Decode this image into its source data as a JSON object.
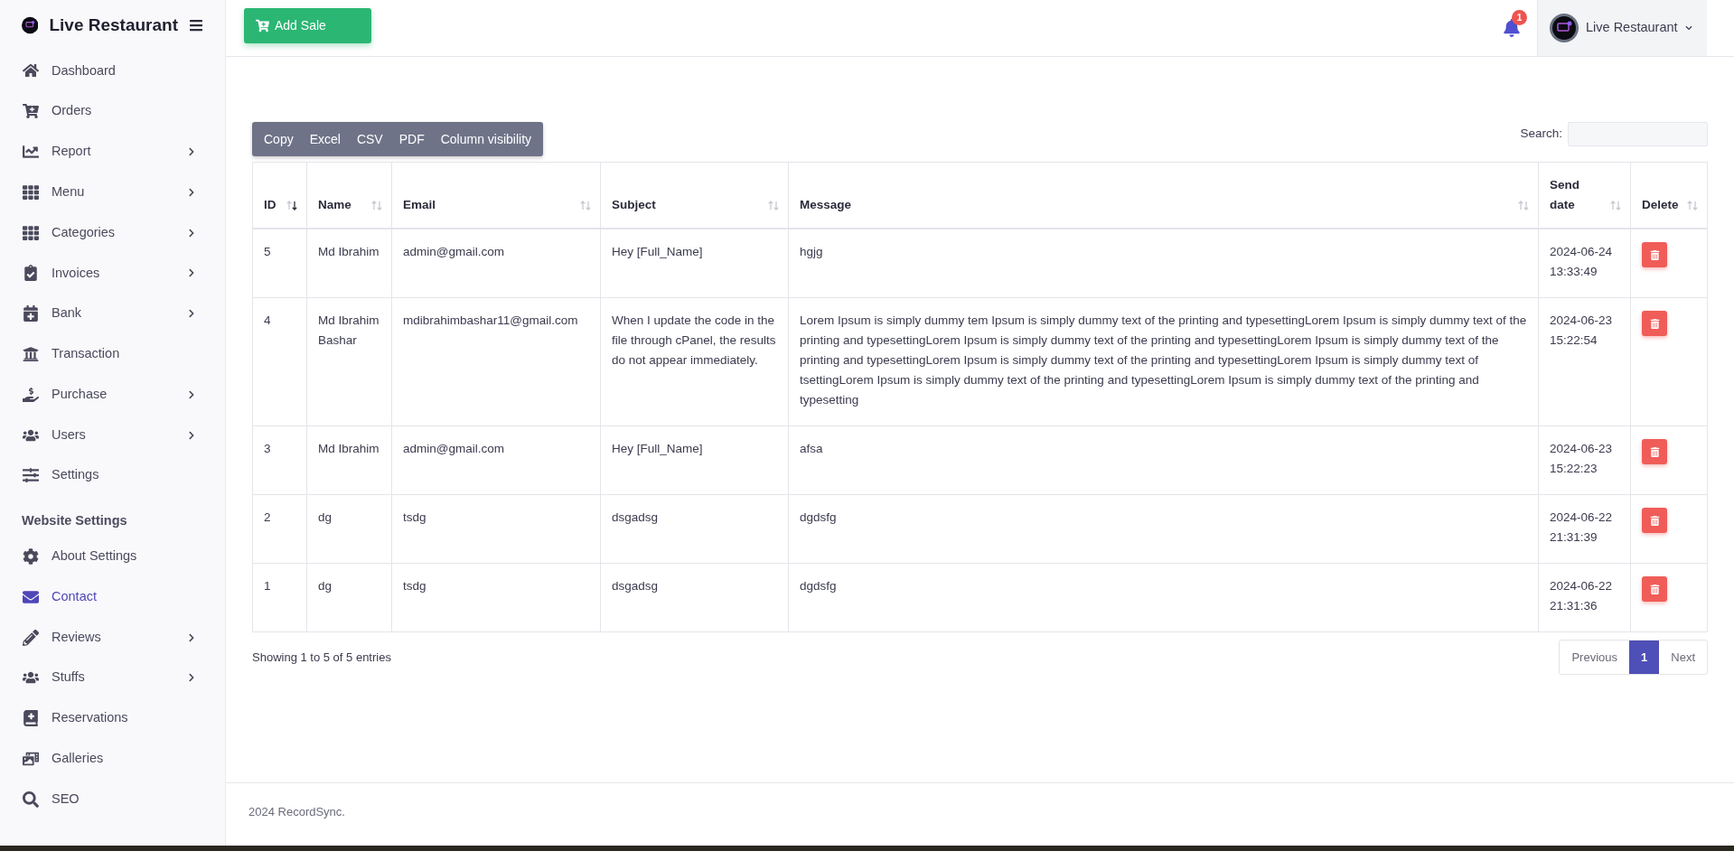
{
  "sidebar": {
    "brand": "Live Restaurant",
    "items": [
      {
        "kind": "link",
        "label": "Dashboard",
        "has_submenu": false,
        "selected": false
      },
      {
        "kind": "link",
        "label": "Orders",
        "has_submenu": false,
        "selected": false
      },
      {
        "kind": "link",
        "label": "Report",
        "has_submenu": true,
        "selected": false
      },
      {
        "kind": "link",
        "label": "Menu",
        "has_submenu": true,
        "selected": false
      },
      {
        "kind": "link",
        "label": "Categories",
        "has_submenu": true,
        "selected": false
      },
      {
        "kind": "link",
        "label": "Invoices",
        "has_submenu": true,
        "selected": false
      },
      {
        "kind": "link",
        "label": "Bank",
        "has_submenu": true,
        "selected": false
      },
      {
        "kind": "link",
        "label": "Transaction",
        "has_submenu": false,
        "selected": false
      },
      {
        "kind": "link",
        "label": "Purchase",
        "has_submenu": true,
        "selected": false
      },
      {
        "kind": "link",
        "label": "Users",
        "has_submenu": true,
        "selected": false
      },
      {
        "kind": "link",
        "label": "Settings",
        "has_submenu": false,
        "selected": false
      },
      {
        "kind": "heading",
        "label": "Website Settings"
      },
      {
        "kind": "link",
        "label": "About Settings",
        "has_submenu": false,
        "selected": false
      },
      {
        "kind": "link",
        "label": "Contact",
        "has_submenu": false,
        "selected": true
      },
      {
        "kind": "link",
        "label": "Reviews",
        "has_submenu": true,
        "selected": false
      },
      {
        "kind": "link",
        "label": "Stuffs",
        "has_submenu": true,
        "selected": false
      },
      {
        "kind": "link",
        "label": "Reservations",
        "has_submenu": false,
        "selected": false
      },
      {
        "kind": "link",
        "label": "Galleries",
        "has_submenu": false,
        "selected": false
      },
      {
        "kind": "link",
        "label": "SEO",
        "has_submenu": false,
        "selected": false
      }
    ]
  },
  "topbar": {
    "add_button": "Add Sale",
    "notification_count": "1",
    "user_name": "Live Restaurant"
  },
  "export_buttons": [
    "Copy",
    "Excel",
    "CSV",
    "PDF",
    "Column visibility"
  ],
  "search": {
    "label": "Search:"
  },
  "table": {
    "columns": [
      {
        "label": "ID",
        "sorted_desc": true
      },
      {
        "label": "Name",
        "sorted_desc": false
      },
      {
        "label": "Email",
        "sorted_desc": false
      },
      {
        "label": "Subject",
        "sorted_desc": false
      },
      {
        "label": "Message",
        "sorted_desc": false
      },
      {
        "label": "Send date",
        "sorted_desc": false
      },
      {
        "label": "Delete",
        "sorted_desc": false
      }
    ],
    "rows": [
      {
        "id": "5",
        "name": "Md Ibrahim",
        "email": "admin@gmail.com",
        "subject": "Hey [Full_Name]",
        "message": "hgjg",
        "send_date": "2024-06-24 13:33:49"
      },
      {
        "id": "4",
        "name": "Md Ibrahim Bashar",
        "email": "mdibrahimbashar11@gmail.com",
        "subject": "When I update the code in the file through cPanel, the results do not appear immediately.",
        "message": "Lorem Ipsum is simply dummy tem Ipsum is simply dummy text of the printing and typesettingLorem Ipsum is simply dummy text of the printing and typesettingLorem Ipsum is simply dummy text of the printing and typesettingLorem Ipsum is simply dummy text of the printing and typesettingLorem Ipsum is simply dummy text of the printing and typesettingLorem Ipsum is simply dummy text of tsettingLorem Ipsum is simply dummy text of the printing and typesettingLorem Ipsum is simply dummy text of the printing and typesetting",
        "send_date": "2024-06-23 15:22:54"
      },
      {
        "id": "3",
        "name": "Md Ibrahim",
        "email": "admin@gmail.com",
        "subject": "Hey [Full_Name]",
        "message": "afsa",
        "send_date": "2024-06-23 15:22:23"
      },
      {
        "id": "2",
        "name": "dg",
        "email": "tsdg",
        "subject": "dsgadsg",
        "message": "dgdsfg",
        "send_date": "2024-06-22 21:31:39"
      },
      {
        "id": "1",
        "name": "dg",
        "email": "tsdg",
        "subject": "dsgadsg",
        "message": "dgdsfg",
        "send_date": "2024-06-22 21:31:36"
      }
    ]
  },
  "info": "Showing 1 to 5 of 5 entries",
  "pagination": [
    {
      "label": "Previous",
      "selected": false
    },
    {
      "label": "1",
      "selected": true
    },
    {
      "label": "Next",
      "selected": false
    }
  ],
  "footer": "2024 RecordSync."
}
